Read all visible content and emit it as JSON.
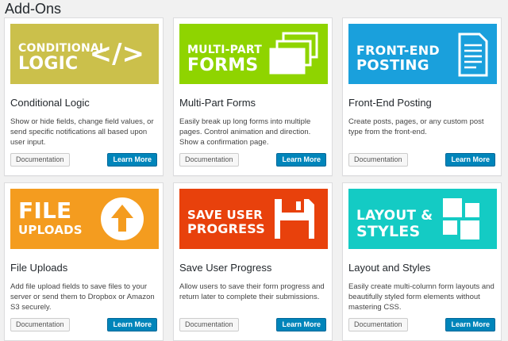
{
  "header": {
    "title": "Add-Ons"
  },
  "cards": [
    {
      "banner_line1": "Conditional",
      "banner_line2": "Logic",
      "banner_color": "#cbc04b",
      "icon": "code-icon",
      "icon_text": "</>",
      "title": "Conditional Logic",
      "description": "Show or hide fields, change field values, or send specific notifications all based upon user input.",
      "doc_label": "Documentation",
      "learn_label": "Learn More"
    },
    {
      "banner_line1": "Multi-Part",
      "banner_line2": "Forms",
      "banner_color": "#8fd400",
      "icon": "stacked-pages-icon",
      "title": "Multi-Part Forms",
      "description": "Easily break up long forms into multiple pages. Control animation and direction. Show a confirmation page.",
      "doc_label": "Documentation",
      "learn_label": "Learn More"
    },
    {
      "banner_line1": "Front-End",
      "banner_line2": "Posting",
      "banner_color": "#1aa0dc",
      "icon": "document-icon",
      "title": "Front-End Posting",
      "description": "Create posts, pages, or any custom post type from the front-end.",
      "doc_label": "Documentation",
      "learn_label": "Learn More"
    },
    {
      "banner_line1": "File",
      "banner_line2": "Uploads",
      "banner_color": "#f49c1f",
      "icon": "upload-arrow-icon",
      "title": "File Uploads",
      "description": "Add file upload fields to save files to your server or send them to Dropbox or Amazon S3 securely.",
      "doc_label": "Documentation",
      "learn_label": "Learn More"
    },
    {
      "banner_line1": "Save User",
      "banner_line2": "Progress",
      "banner_color": "#e8410c",
      "icon": "floppy-disk-icon",
      "title": "Save User Progress",
      "description": "Allow users to save their form progress and return later to complete their submissions.",
      "doc_label": "Documentation",
      "learn_label": "Learn More"
    },
    {
      "banner_line1": "Layout &",
      "banner_line2": "Styles",
      "banner_color": "#14cbc4",
      "icon": "layout-blocks-icon",
      "title": "Layout and Styles",
      "description": "Easily create multi-column form layouts and beautifully styled form elements without mastering CSS.",
      "doc_label": "Documentation",
      "learn_label": "Learn More"
    }
  ]
}
